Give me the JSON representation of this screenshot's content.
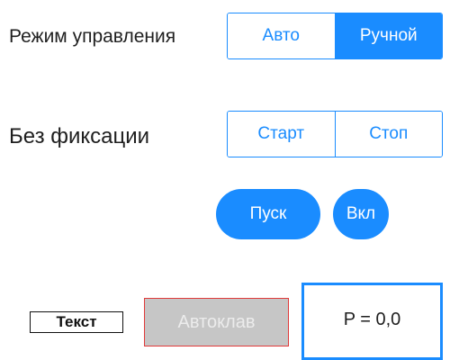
{
  "control_mode": {
    "label": "Режим управления",
    "options": [
      "Авто",
      "Ручной"
    ],
    "selected": "Ручной"
  },
  "fixation": {
    "label": "Без фиксации",
    "buttons": [
      "Старт",
      "Стоп"
    ]
  },
  "actions": {
    "pusk_label": "Пуск",
    "vkl_label": "Вкл"
  },
  "bottom": {
    "text_box_label": "Текст",
    "disabled_button_label": "Автоклав",
    "value_display": "P = 0,0"
  },
  "colors": {
    "accent": "#1a8cff",
    "disabled_bg": "#c6c6c6",
    "disabled_border": "#e03a3a"
  }
}
